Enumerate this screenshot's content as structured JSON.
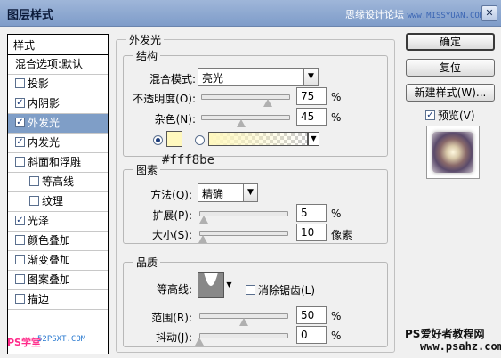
{
  "window": {
    "title": "图层样式",
    "watermark_site_cn": "思缘设计论坛",
    "watermark_site_en": "www.MISSYUAN.COM",
    "close_icon": "close-icon"
  },
  "left": {
    "header": "样式",
    "items": [
      {
        "label": "混合选项:默认",
        "checkbox": false,
        "has_checkbox": false
      },
      {
        "label": "投影",
        "checked": false
      },
      {
        "label": "内阴影",
        "checked": true
      },
      {
        "label": "外发光",
        "checked": true,
        "selected": true
      },
      {
        "label": "内发光",
        "checked": true
      },
      {
        "label": "斜面和浮雕",
        "checked": false
      },
      {
        "label": "等高线",
        "checked": false,
        "indent": true
      },
      {
        "label": "纹理",
        "checked": false,
        "indent": true
      },
      {
        "label": "光泽",
        "checked": true
      },
      {
        "label": "颜色叠加",
        "checked": false
      },
      {
        "label": "渐变叠加",
        "checked": false
      },
      {
        "label": "图案叠加",
        "checked": false
      },
      {
        "label": "描边",
        "checked": false
      }
    ],
    "watermark_a": "PS学堂",
    "watermark_b": "52PSXT.COM"
  },
  "panel": {
    "section_title": "外发光",
    "structure": {
      "title": "结构",
      "blend_label": "混合模式:",
      "blend_value": "亮光",
      "opacity_label": "不透明度(O):",
      "opacity_value": "75",
      "opacity_unit": "%",
      "opacity_fraction": 0.75,
      "noise_label": "杂色(N):",
      "noise_value": "45",
      "noise_unit": "%",
      "noise_fraction": 0.45,
      "color_hex_label": "#fff8be",
      "glow_color": "#fff8be"
    },
    "elements": {
      "title": "图素",
      "method_label": "方法(Q):",
      "method_value": "精确",
      "spread_label": "扩展(P):",
      "spread_value": "5",
      "spread_unit": "%",
      "spread_fraction": 0.05,
      "size_label": "大小(S):",
      "size_value": "10",
      "size_unit": "像素",
      "size_fraction": 0.04
    },
    "quality": {
      "title": "品质",
      "contour_label": "等高线:",
      "antialias_label": "消除锯齿(L)",
      "antialias_checked": false,
      "range_label": "范围(R):",
      "range_value": "50",
      "range_unit": "%",
      "range_fraction": 0.5,
      "jitter_label": "抖动(J):",
      "jitter_value": "0",
      "jitter_unit": "%",
      "jitter_fraction": 0.0
    }
  },
  "right": {
    "ok": "确定",
    "reset": "复位",
    "new_style": "新建样式(W)...",
    "preview_label": "预览(V)",
    "preview_checked": true,
    "watermark_cn": "PS爱好者教程网",
    "watermark_en": "www.psahz.com"
  }
}
